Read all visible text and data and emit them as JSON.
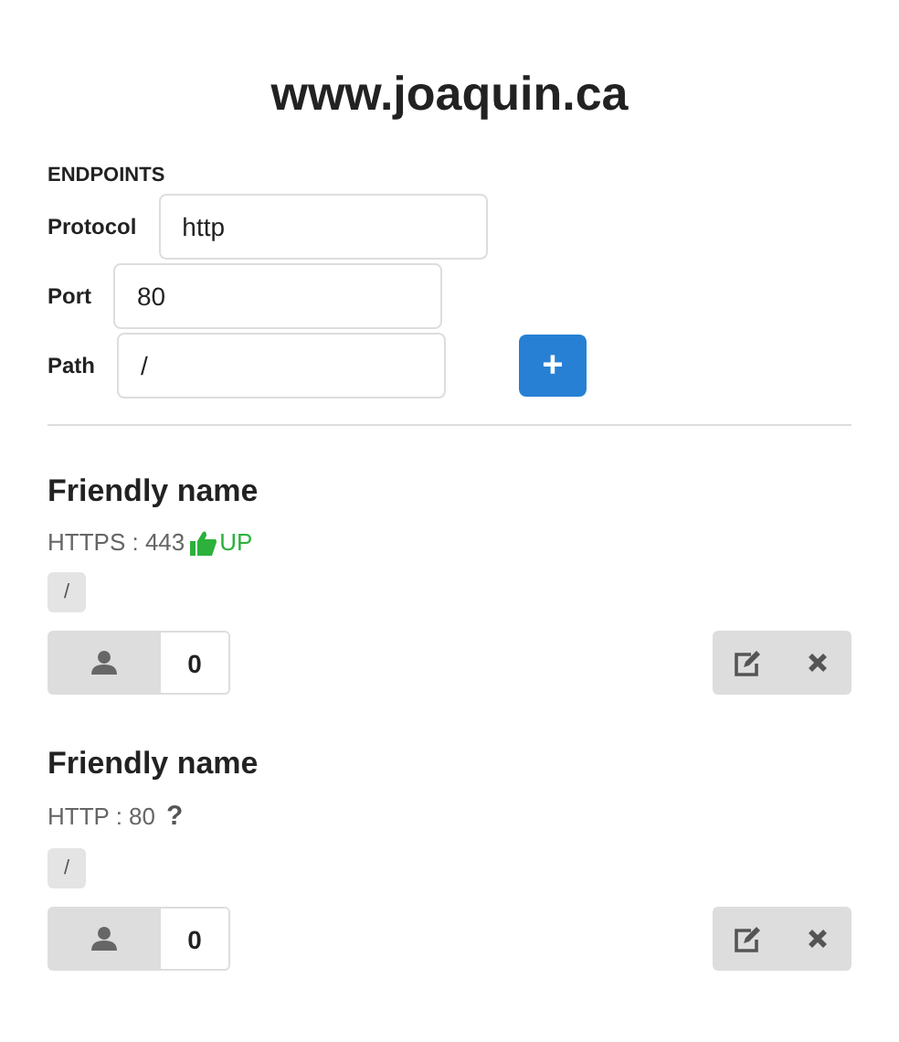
{
  "title": "www.joaquin.ca",
  "form": {
    "heading": "ENDPOINTS",
    "fields": [
      {
        "label": "Protocol",
        "value": "http"
      },
      {
        "label": "Port",
        "value": "80"
      },
      {
        "label": "Path",
        "value": "/"
      }
    ],
    "add_button": "+"
  },
  "endpoints": [
    {
      "name": "Friendly name",
      "address": "HTTPS : 443",
      "status": {
        "kind": "up",
        "label": "UP"
      },
      "path": "/",
      "count": "0"
    },
    {
      "name": "Friendly name",
      "address": "HTTP : 80",
      "status": {
        "kind": "unknown",
        "label": "?"
      },
      "path": "/",
      "count": "0"
    }
  ]
}
